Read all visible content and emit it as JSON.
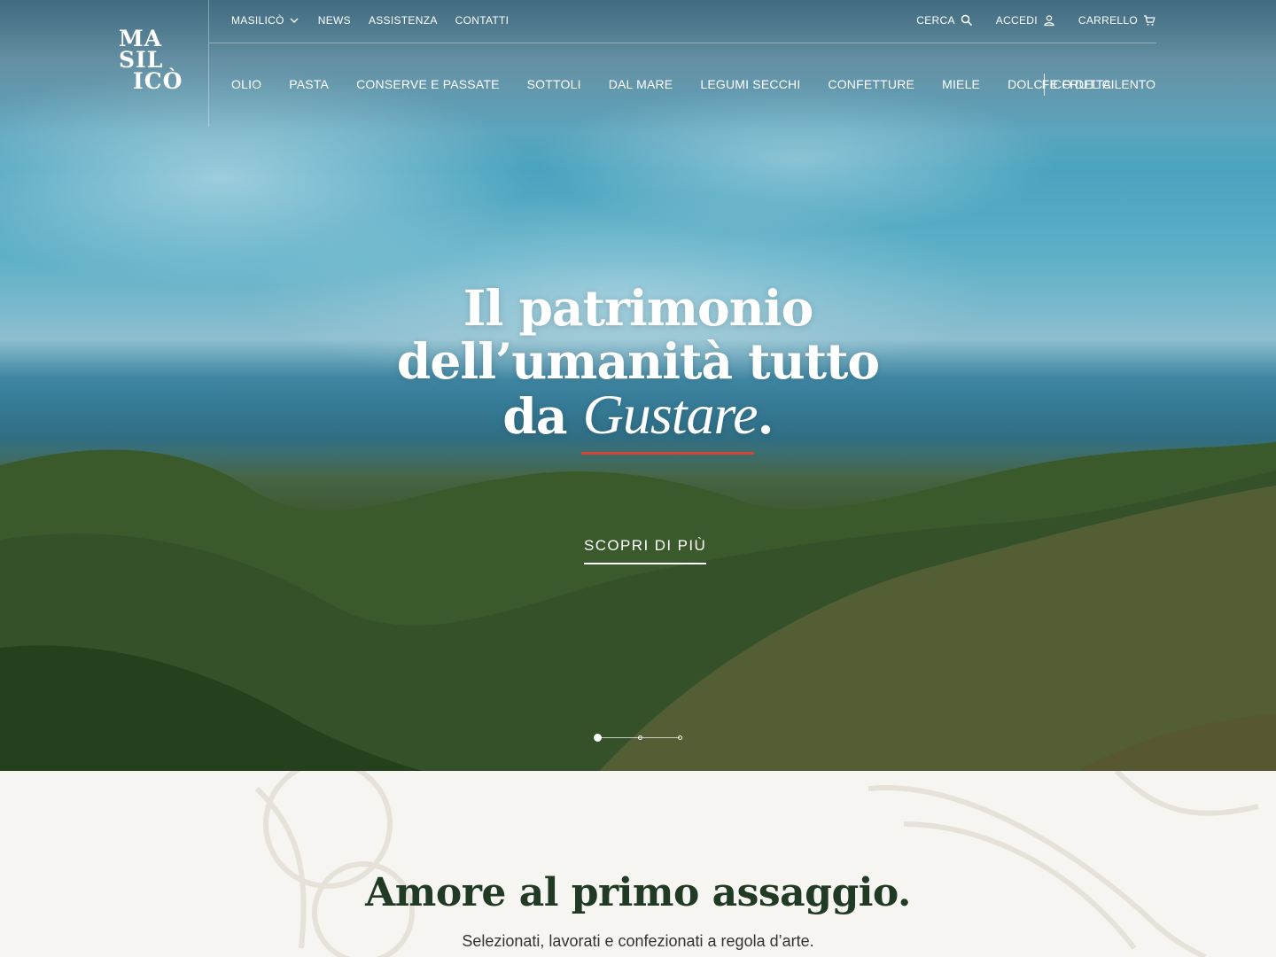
{
  "logo": {
    "line1": "MA",
    "line2": "SIL",
    "line3": "ICÒ"
  },
  "topnav": [
    {
      "label": "MASILICÒ",
      "dropdown": true
    },
    {
      "label": "NEWS"
    },
    {
      "label": "ASSISTENZA"
    },
    {
      "label": "CONTATTI"
    }
  ],
  "utility": {
    "search": "CERCA",
    "login": "ACCEDI",
    "cart": "CARRELLO"
  },
  "mainnav": [
    "OLIO",
    "PASTA",
    "CONSERVE E PASSATE",
    "SOTTOLI",
    "DAL MARE",
    "LEGUMI SECCHI",
    "CONFETTURE",
    "MIELE",
    "DOLCI E FRUTTA"
  ],
  "special_nav": "FICO DEL CILENTO",
  "hero": {
    "line1": "Il patrimonio",
    "line2": "dell’umanità tutto",
    "line3_prefix": "da ",
    "line3_emphasis": "Gustare",
    "line3_suffix": ".",
    "cta": "SCOPRI DI PIÙ",
    "slides_total": 3,
    "active_slide": 1
  },
  "section": {
    "title": "Amore al primo assaggio.",
    "subtitle": "Selezionati, lavorati e confezionati a regola d’arte."
  },
  "colors": {
    "accent_red": "#d64534",
    "heading_green": "#203a24",
    "background": "#f7f5f1"
  },
  "icons": [
    "chevron-down-icon",
    "search-icon",
    "user-icon",
    "cart-icon"
  ]
}
